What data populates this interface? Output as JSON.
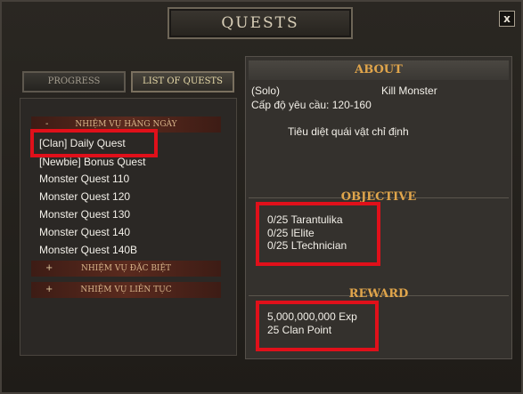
{
  "window": {
    "title": "QUESTS",
    "close_label": "x"
  },
  "tabs": [
    {
      "label": "PROGRESS"
    },
    {
      "label": "LIST OF QUESTS"
    }
  ],
  "categories": [
    {
      "symbol": "-",
      "label": "NHIỆM VỤ HÀNG NGÀY"
    },
    {
      "symbol": "+",
      "label": "NHIỆM VỤ ĐẶC BIỆT"
    },
    {
      "symbol": "+",
      "label": "NHIỆM VỤ LIÊN TỤC"
    }
  ],
  "quests": [
    "[Clan] Daily Quest",
    "[Newbie] Bonus Quest",
    "Monster Quest 110",
    "Monster Quest 120",
    "Monster Quest 130",
    "Monster Quest 140",
    "Monster Quest 140B"
  ],
  "about": {
    "heading": "ABOUT",
    "mode": "(Solo)",
    "type": "Kill Monster",
    "level_req": "Cấp độ yêu cầu: 120-160",
    "description": "Tiêu diệt quái vật chỉ định"
  },
  "objective": {
    "heading": "OBJECTIVE",
    "items": [
      "0/25 Tarantulika",
      "0/25 lElite",
      "0/25 LTechnician"
    ]
  },
  "reward": {
    "heading": "REWARD",
    "items": [
      "5,000,000,000 Exp",
      "25 Clan Point"
    ]
  },
  "colors": {
    "heading": "#e0a54b",
    "highlight": "#e0101a",
    "category_bar": "#5a2a1e"
  }
}
